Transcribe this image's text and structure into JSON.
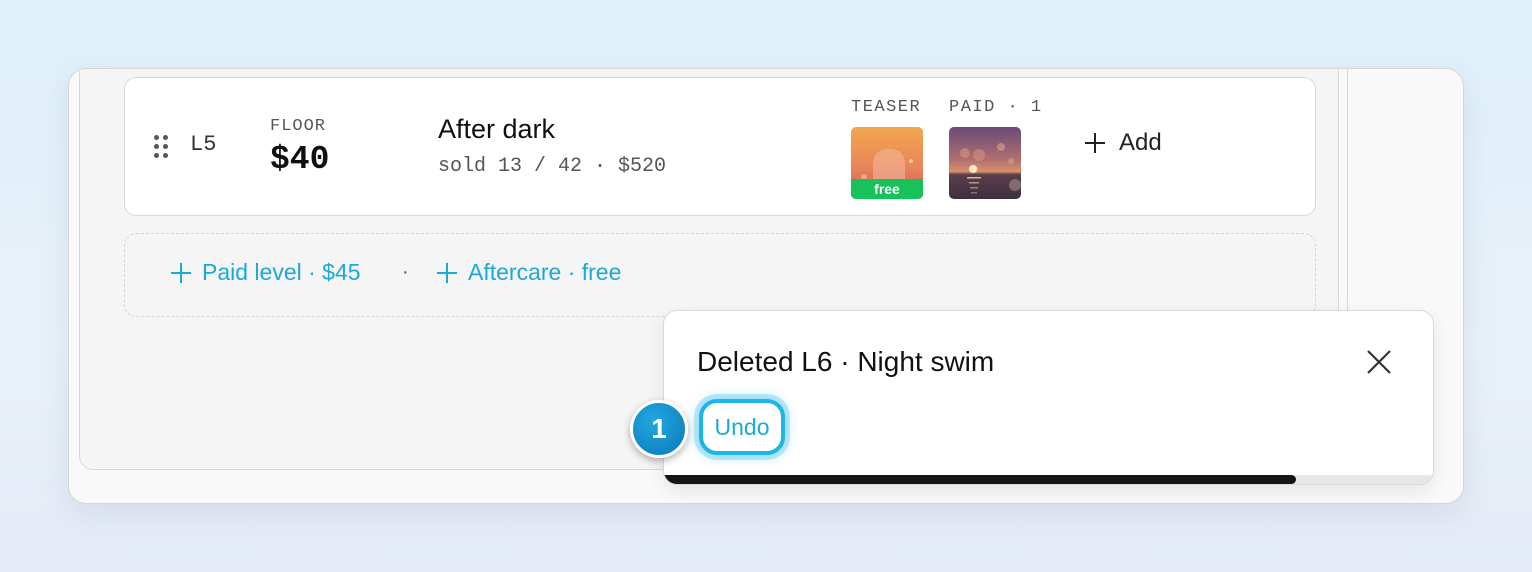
{
  "level": {
    "id": "L5",
    "floor_label": "FLOOR",
    "floor_price": "$40",
    "title": "After dark",
    "stats": "sold 13 / 42 · $520",
    "teaser_label": "TEASER",
    "paid_label": "PAID · 1",
    "teaser_badge": "free",
    "add_label": "Add"
  },
  "quick_add": {
    "paid_level": "Paid level · $45",
    "separator": "·",
    "aftercare": "Aftercare · free"
  },
  "toast": {
    "message": "Deleted L6 · Night swim",
    "undo_label": "Undo",
    "progress": 0.82
  },
  "step_badge": "1",
  "icons": {
    "drag": "drag-handle-icon",
    "plus": "plus-icon",
    "close": "close-icon"
  },
  "colors": {
    "accent": "#1aa9d9",
    "free_badge": "#17c25a",
    "progress": "#151515"
  }
}
